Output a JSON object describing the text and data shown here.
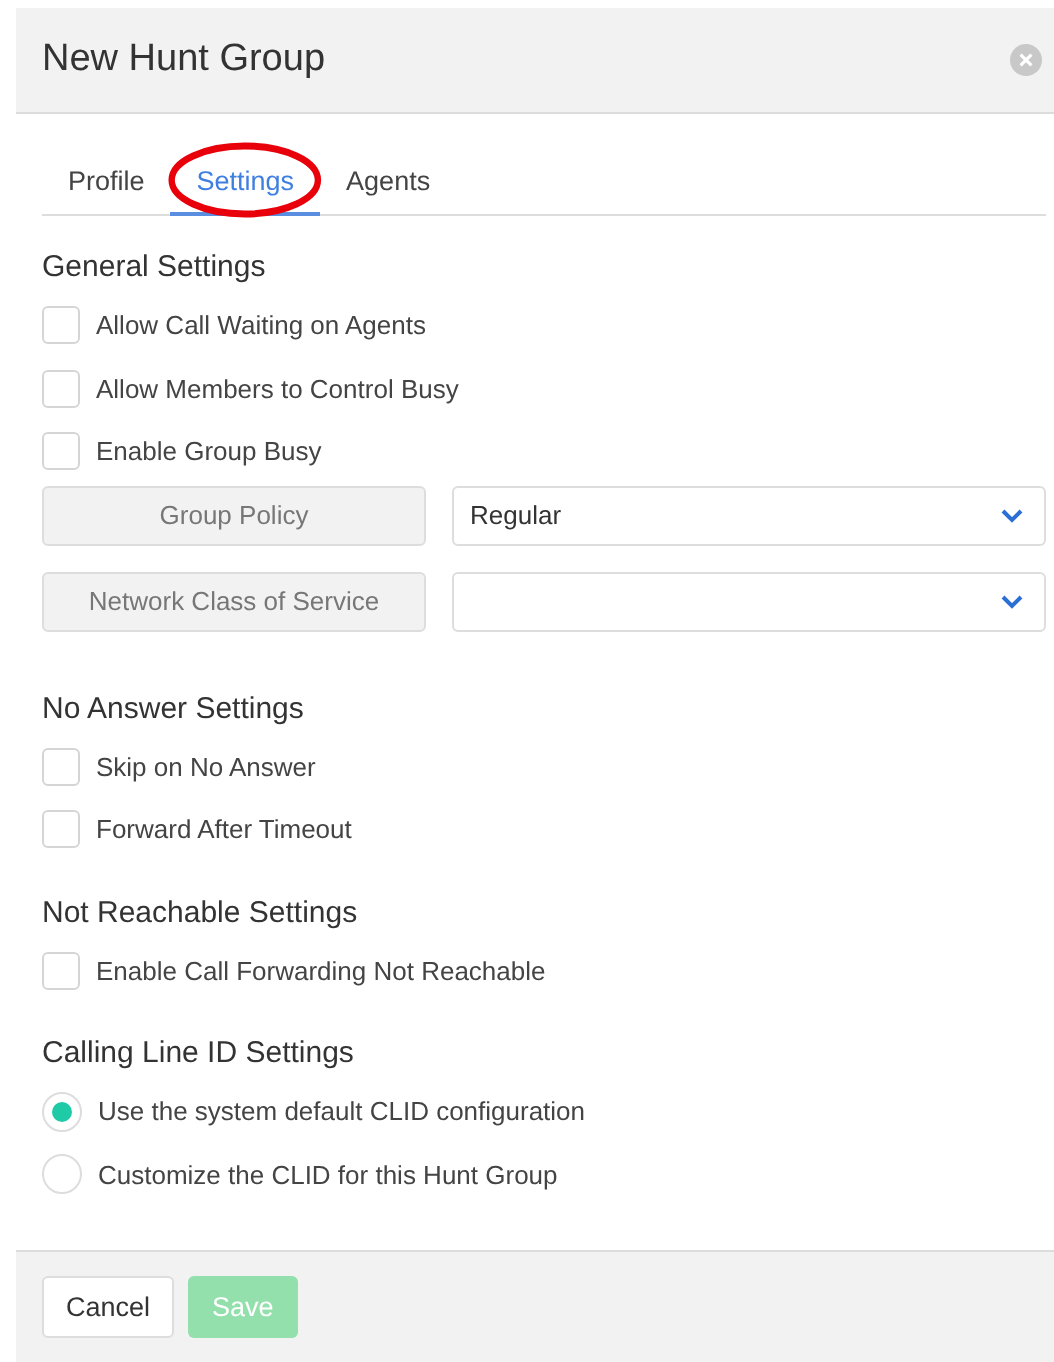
{
  "dialog": {
    "title": "New Hunt Group"
  },
  "tabs": [
    {
      "label": "Profile",
      "selected": false,
      "circled": false
    },
    {
      "label": "Settings",
      "selected": true,
      "circled": true
    },
    {
      "label": "Agents",
      "selected": false,
      "circled": false
    }
  ],
  "sections": [
    {
      "title": "General Settings",
      "items": [
        {
          "kind": "checkbox",
          "label": "Allow Call Waiting on Agents",
          "checked": false
        },
        {
          "kind": "checkbox",
          "label": "Allow Members to Control Busy",
          "checked": false
        },
        {
          "kind": "checkbox",
          "label": "Enable Group Busy",
          "checked": false
        },
        {
          "kind": "select",
          "label": "Group Policy",
          "value": "Regular"
        },
        {
          "kind": "select",
          "label": "Network Class of Service"
        }
      ]
    },
    {
      "title": "No Answer Settings",
      "items": [
        {
          "kind": "checkbox",
          "label": "Skip on No Answer",
          "checked": false
        },
        {
          "kind": "checkbox",
          "label": "Forward After Timeout",
          "checked": false
        }
      ]
    },
    {
      "title": "Not Reachable Settings",
      "items": [
        {
          "kind": "checkbox",
          "label": "Enable Call Forwarding Not Reachable",
          "checked": false
        }
      ]
    },
    {
      "title": "Calling Line ID Settings",
      "items": [
        {
          "kind": "radio",
          "label": "Use the system default CLID configuration",
          "selected": true
        },
        {
          "kind": "radio",
          "label": "Customize the CLID for this Hunt Group",
          "selected": false
        }
      ]
    }
  ],
  "buttons": [
    {
      "label": "Cancel",
      "kind": "secondary",
      "disabled": false
    },
    {
      "label": "Save",
      "kind": "primary",
      "disabled": true
    }
  ]
}
